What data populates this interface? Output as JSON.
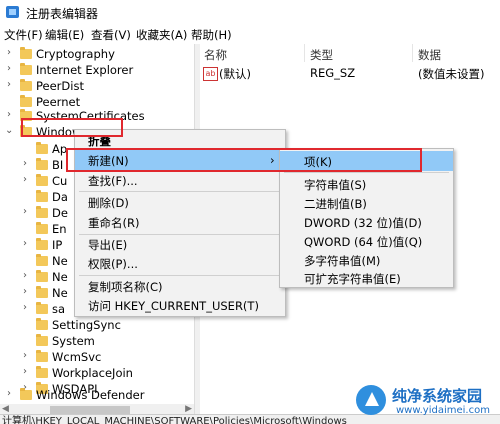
{
  "window": {
    "title": "注册表编辑器"
  },
  "menubar": [
    "文件(F)",
    "编辑(E)",
    "查看(V)",
    "收藏夹(A)",
    "帮助(H)"
  ],
  "tree": [
    {
      "label": "Cryptography",
      "expander": "›"
    },
    {
      "label": "Internet Explorer",
      "expander": "›"
    },
    {
      "label": "PeerDist",
      "expander": "›"
    },
    {
      "label": "Peernet",
      "expander": ""
    },
    {
      "label": "SystemCertificates",
      "expander": "›"
    },
    {
      "label": "Windows",
      "expander": "⌄"
    },
    {
      "label": "Ap",
      "expander": ""
    },
    {
      "label": "BI",
      "expander": "›"
    },
    {
      "label": "Cu",
      "expander": "›"
    },
    {
      "label": "Da",
      "expander": ""
    },
    {
      "label": "De",
      "expander": "›"
    },
    {
      "label": "En",
      "expander": ""
    },
    {
      "label": "IP",
      "expander": "›"
    },
    {
      "label": "Ne",
      "expander": ""
    },
    {
      "label": "Ne",
      "expander": "›"
    },
    {
      "label": "Ne",
      "expander": "›"
    },
    {
      "label": "sa",
      "expander": "›"
    },
    {
      "label": "SettingSync",
      "expander": ""
    },
    {
      "label": "System",
      "expander": ""
    },
    {
      "label": "WcmSvc",
      "expander": "›"
    },
    {
      "label": "WorkplaceJoin",
      "expander": "›"
    },
    {
      "label": "WSDAPI",
      "expander": "›"
    },
    {
      "label": "Windows Defender",
      "expander": "›"
    }
  ],
  "values_pane": {
    "columns": [
      "名称",
      "类型",
      "数据"
    ],
    "rows": [
      {
        "name": "(默认)",
        "type": "REG_SZ",
        "data": "(数值未设置)"
      }
    ]
  },
  "statusbar": "计算机\\HKEY_LOCAL_MACHINE\\SOFTWARE\\Policies\\Microsoft\\Windows",
  "context_menu": {
    "header": "折叠",
    "items": [
      {
        "label": "新建(N)",
        "submenu": "›"
      },
      {
        "label": "查找(F)..."
      },
      {
        "label": "删除(D)"
      },
      {
        "label": "重命名(R)"
      },
      {
        "label": "导出(E)"
      },
      {
        "label": "权限(P)..."
      },
      {
        "label": "复制项名称(C)"
      },
      {
        "label": "访问 HKEY_CURRENT_USER(T)"
      }
    ]
  },
  "submenu": {
    "items": [
      "项(K)",
      "字符串值(S)",
      "二进制值(B)",
      "DWORD (32 位)值(D)",
      "QWORD (64 位)值(Q)",
      "多字符串值(M)",
      "可扩充字符串值(E)"
    ]
  },
  "watermark": {
    "title": "纯净系统家园",
    "url": "www.yidaimei.com"
  },
  "colors": {
    "highlight": "#91c9f7",
    "annotation_red": "#e0282e",
    "folder": "#f3c85a"
  }
}
